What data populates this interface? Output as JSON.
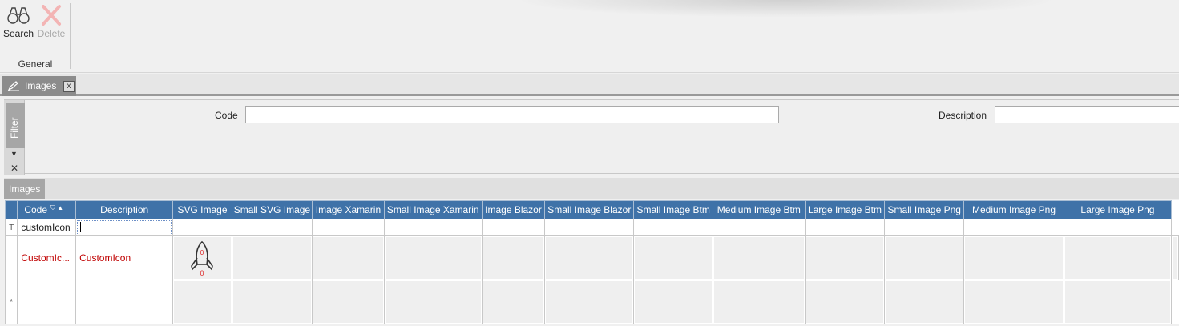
{
  "ribbon": {
    "buttons": [
      {
        "label": "Search",
        "icon": "binoculars-icon",
        "enabled": true
      },
      {
        "label": "Delete",
        "icon": "delete-x-icon",
        "enabled": false
      }
    ],
    "group_label": "General"
  },
  "document_tab": {
    "label": "Images",
    "close": "x"
  },
  "filter": {
    "tab_label": "Filter",
    "fields": [
      {
        "label": "Code",
        "value": ""
      },
      {
        "label": "Description",
        "value": ""
      }
    ]
  },
  "grid_tab": {
    "label": "Images"
  },
  "grid": {
    "columns": [
      "Code",
      "Description",
      "SVG Image",
      "Small SVG Image",
      "Image Xamarin",
      "Small Image Xamarin",
      "Image Blazor",
      "Small Image Blazor",
      "Small Image Btm",
      "Medium Image Btm",
      "Large Image Btm",
      "Small Image Png",
      "Medium Image Png",
      "Large Image Png"
    ],
    "filter_row": {
      "code": "customIcon",
      "description": ""
    },
    "rows": [
      {
        "code": "CustomIc...",
        "description": "CustomIcon",
        "svg_image": "rocket-icon",
        "rocket_digits": [
          "0",
          "0"
        ]
      }
    ],
    "new_row_indicator": "*",
    "filter_row_indicator": "T"
  },
  "colors": {
    "header": "#3f72a8",
    "data_text": "#c00000"
  }
}
